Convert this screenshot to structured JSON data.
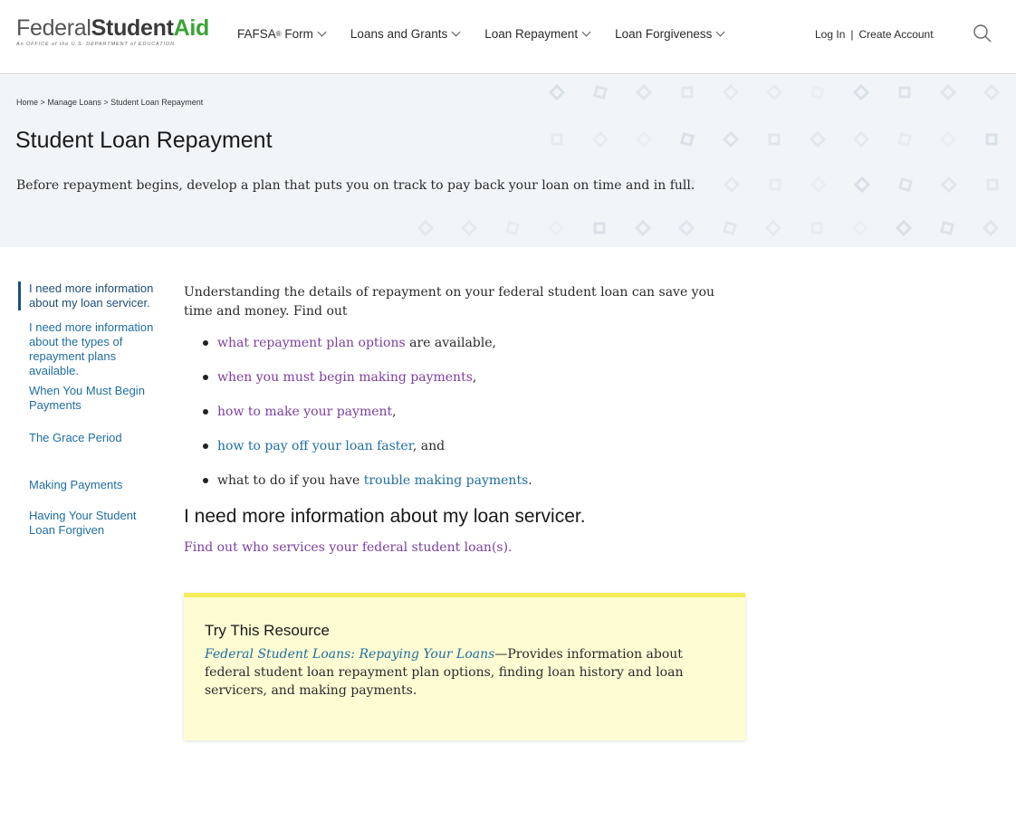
{
  "header": {
    "logo": {
      "word1": "Federal",
      "word2": "Student",
      "word3": "Aid",
      "tagline": "An OFFICE of the U.S. DEPARTMENT of EDUCATION"
    },
    "nav": [
      {
        "label": "FAFSA",
        "sup": "®",
        "suffix": " Form"
      },
      {
        "label": "Loans and Grants"
      },
      {
        "label": "Loan Repayment"
      },
      {
        "label": "Loan Forgiveness"
      }
    ],
    "login_label": "Log In",
    "separator": "|",
    "create_account_label": "Create Account",
    "search_icon": "search-icon"
  },
  "hero": {
    "breadcrumb": [
      "Home",
      "Manage Loans",
      "Student Loan Repayment"
    ],
    "breadcrumb_sep": ">",
    "title": "Student Loan Repayment",
    "description": "Before repayment begins, develop a plan that puts you on track to pay back your loan on time and in full."
  },
  "sidebar": {
    "items": [
      {
        "label": "I need more information about my loan servicer.",
        "active": true
      },
      {
        "label": "I need more information about the types of repayment plans available."
      },
      {
        "label": "When You Must Begin Payments"
      },
      {
        "label": "The Grace Period"
      },
      {
        "label": "Making Payments"
      },
      {
        "label": "Having Your Student Loan Forgiven"
      }
    ]
  },
  "main": {
    "intro": "Understanding the details of repayment on your federal student loan can save you time and money. Find out",
    "bullets": [
      {
        "pre": "",
        "link": "what repayment plan options",
        "post": " are available,"
      },
      {
        "pre": "",
        "link": "when you must begin making payments",
        "post": ","
      },
      {
        "pre": "",
        "link": "how to make your payment",
        "post": ","
      },
      {
        "pre": "",
        "link": "how to pay off your loan faster",
        "post": ", and"
      },
      {
        "pre": "what to do if you have ",
        "link": "trouble making payments",
        "post": "."
      }
    ],
    "section_title": "I need more information about my loan servicer.",
    "section_link": "Find out who services your federal student loan(s)."
  },
  "resource": {
    "title": "Try This Resource",
    "link": "Federal Student Loans: Repaying Your Loans",
    "text": "—Provides information about federal student loan repayment plan options, finding loan history and loan servicers, and making payments."
  },
  "colors": {
    "link_blue": "#1f6fa1",
    "link_visited": "#7b3fa0",
    "brand_green": "#38a535",
    "resource_bg": "#fefcd3"
  }
}
